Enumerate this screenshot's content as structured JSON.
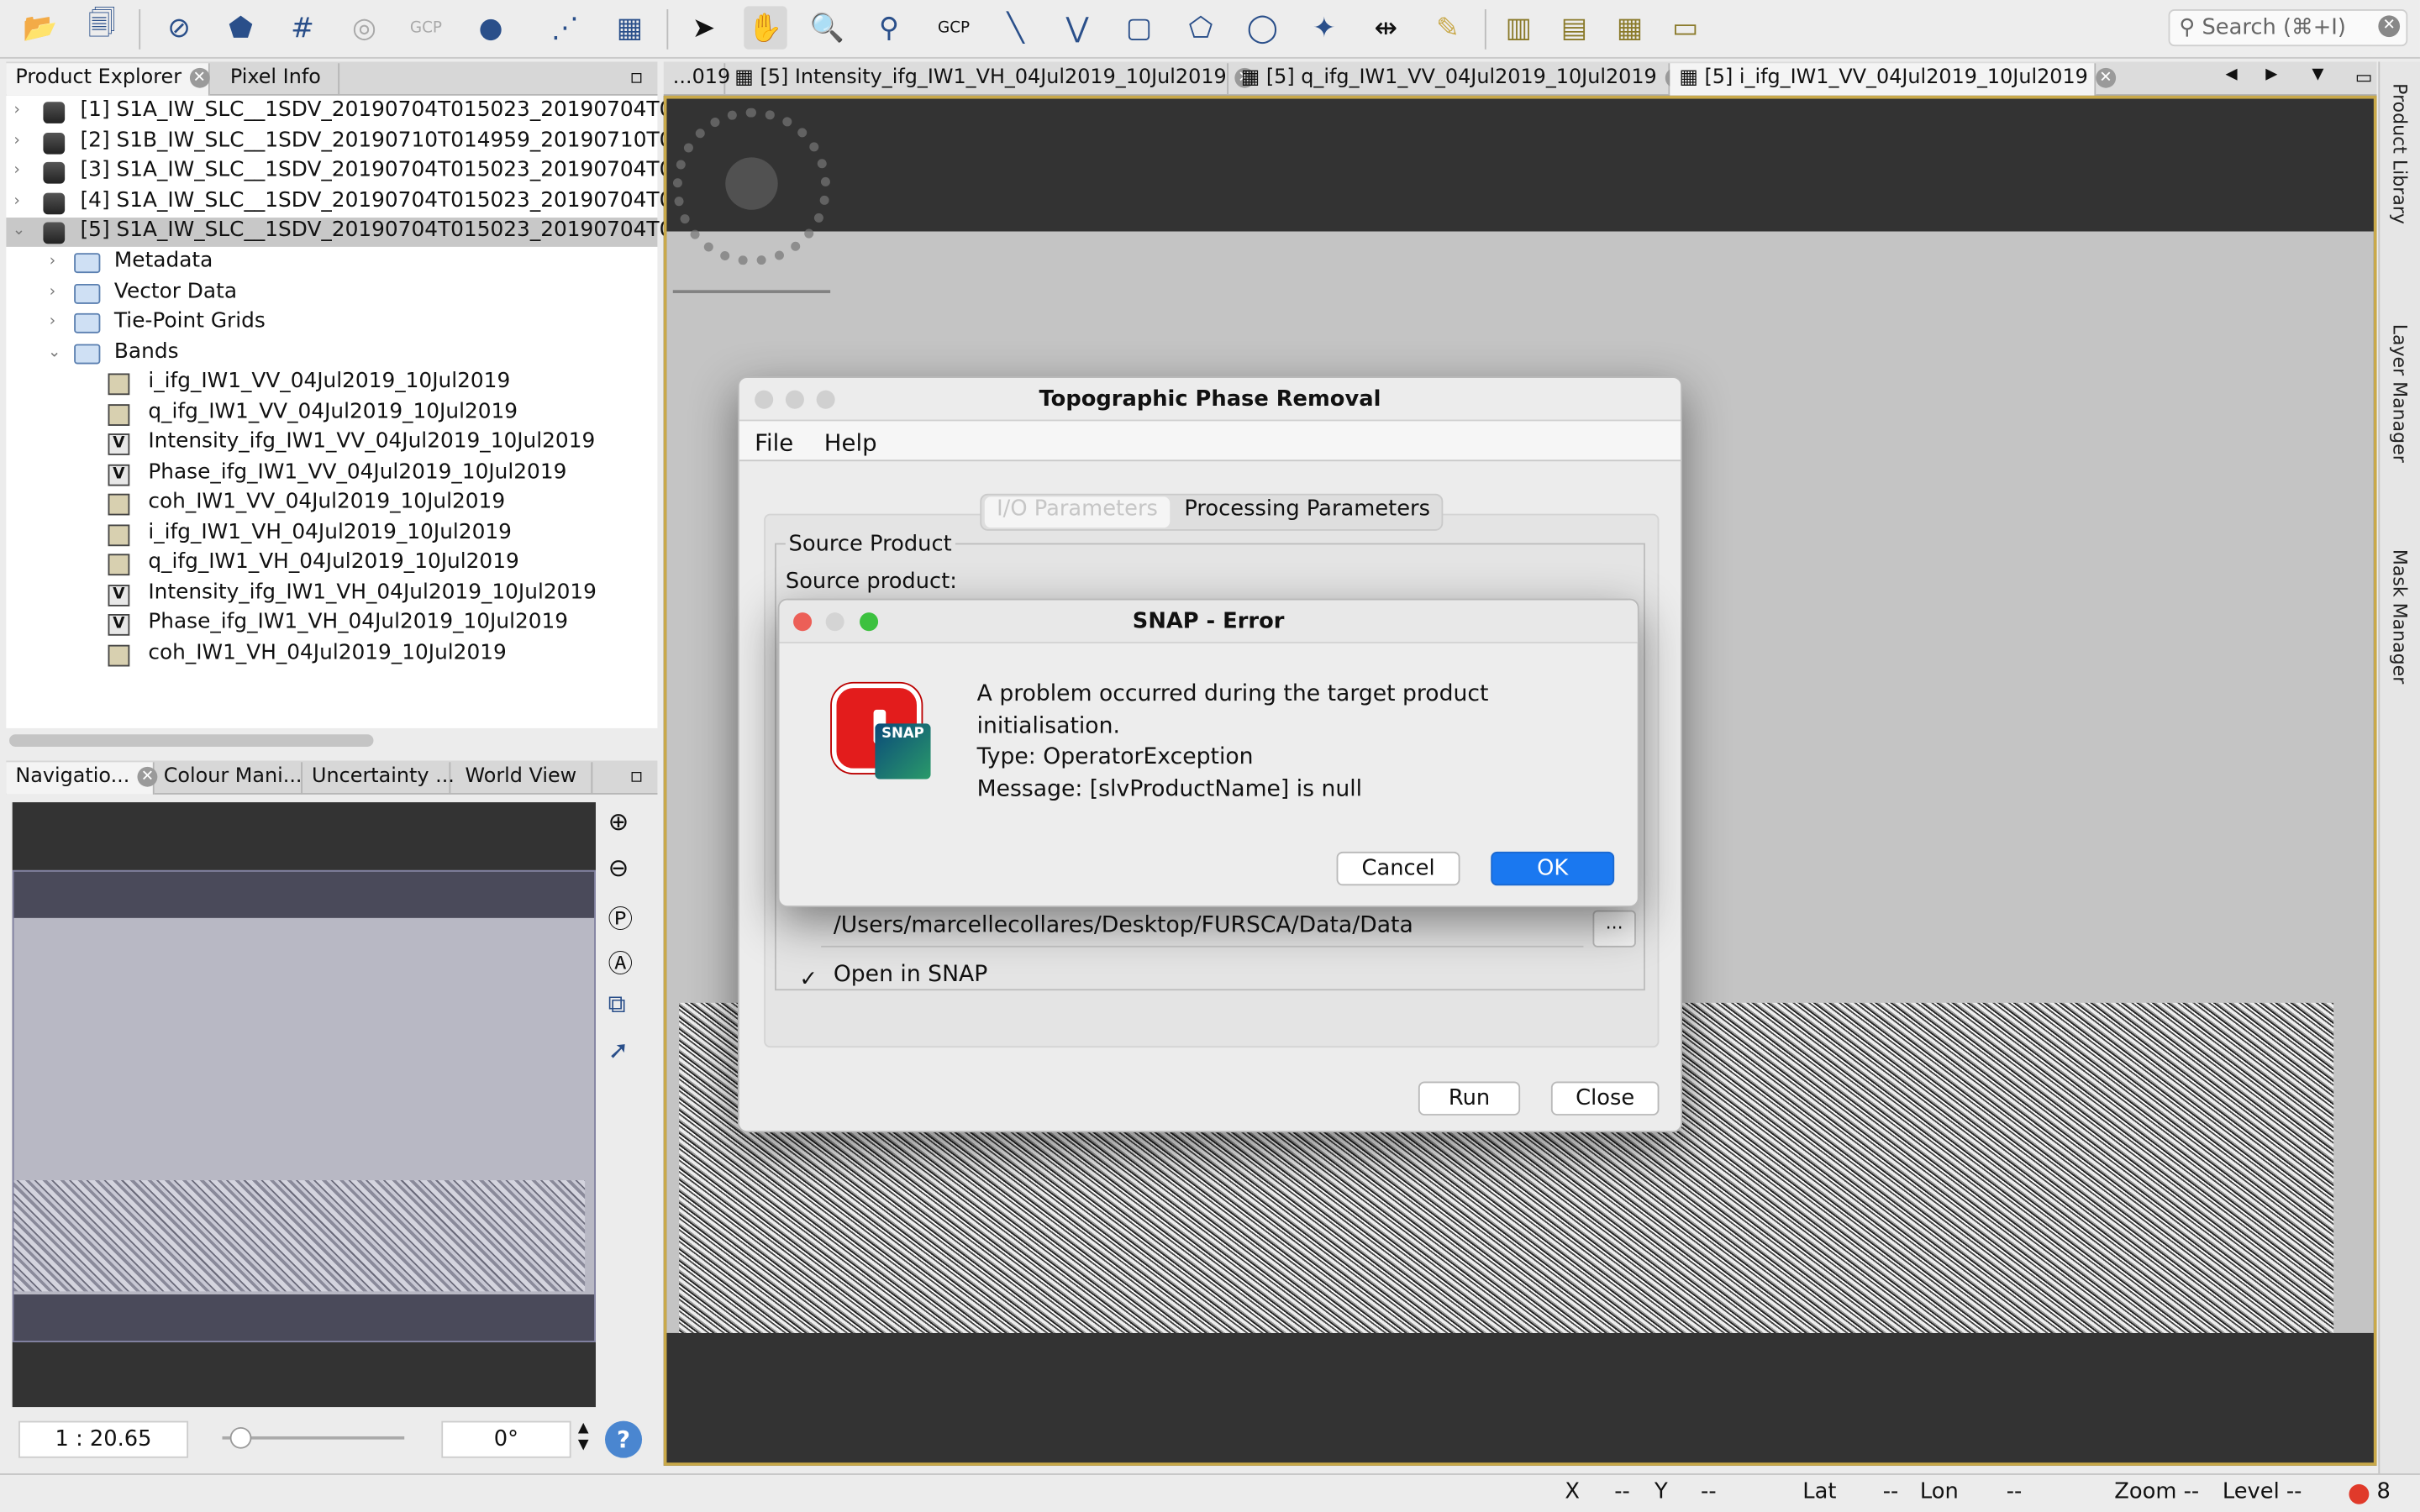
{
  "toolbar": {
    "gcp_label1": "GCP",
    "gcp_label2": "GCP",
    "search_placeholder": "Search (⌘+I)"
  },
  "explorer": {
    "tabs": [
      "Product Explorer",
      "Pixel Info"
    ],
    "products": [
      "[1] S1A_IW_SLC__1SDV_20190704T015023_20190704T0",
      "[2] S1B_IW_SLC__1SDV_20190710T014959_20190710T0",
      "[3] S1A_IW_SLC__1SDV_20190704T015023_20190704T0",
      "[4] S1A_IW_SLC__1SDV_20190704T015023_20190704T0",
      "[5] S1A_IW_SLC__1SDV_20190704T015023_20190704T0"
    ],
    "folders": [
      "Metadata",
      "Vector Data",
      "Tie-Point Grids",
      "Bands"
    ],
    "bands": [
      "i_ifg_IW1_VV_04Jul2019_10Jul2019",
      "q_ifg_IW1_VV_04Jul2019_10Jul2019",
      "Intensity_ifg_IW1_VV_04Jul2019_10Jul2019",
      "Phase_ifg_IW1_VV_04Jul2019_10Jul2019",
      "coh_IW1_VV_04Jul2019_10Jul2019",
      "i_ifg_IW1_VH_04Jul2019_10Jul2019",
      "q_ifg_IW1_VH_04Jul2019_10Jul2019",
      "Intensity_ifg_IW1_VH_04Jul2019_10Jul2019",
      "Phase_ifg_IW1_VH_04Jul2019_10Jul2019",
      "coh_IW1_VH_04Jul2019_10Jul2019"
    ]
  },
  "nav": {
    "tabs": [
      "Navigatio...",
      "Colour Mani...",
      "Uncertainty ...",
      "World View"
    ],
    "scale": "1 : 20.65",
    "rotation": "0°"
  },
  "doc_tabs": [
    "...019",
    "[5] Intensity_ifg_IW1_VH_04Jul2019_10Jul2019",
    "[5] q_ifg_IW1_VV_04Jul2019_10Jul2019",
    "[5] i_ifg_IW1_VV_04Jul2019_10Jul2019"
  ],
  "right_sidebar": [
    "Product Library",
    "Layer Manager",
    "Mask Manager"
  ],
  "dialog": {
    "title": "Topographic Phase Removal",
    "menu": [
      "File",
      "Help"
    ],
    "tabs": [
      "I/O Parameters",
      "Processing Parameters"
    ],
    "source_product_title": "Source Product",
    "source_product_label": "Source product:",
    "directory": "/Users/marcellecollares/Desktop/FURSCA/Data/Data",
    "browse": "...",
    "open_in_snap": "Open in SNAP",
    "run": "Run",
    "close": "Close"
  },
  "error": {
    "title": "SNAP - Error",
    "line1": "A problem occurred during the target product initialisation.",
    "line2": "Type: OperatorException",
    "line3": "Message: [slvProductName] is null",
    "badge": "SNAP",
    "cancel": "Cancel",
    "ok": "OK"
  },
  "status": {
    "x": "X",
    "x_val": "--",
    "y": "Y",
    "y_val": "--",
    "lat": "Lat",
    "lat_val": "--",
    "lon": "Lon",
    "lon_val": "--",
    "zoom": "Zoom --",
    "level": "Level --",
    "errors": "8"
  }
}
